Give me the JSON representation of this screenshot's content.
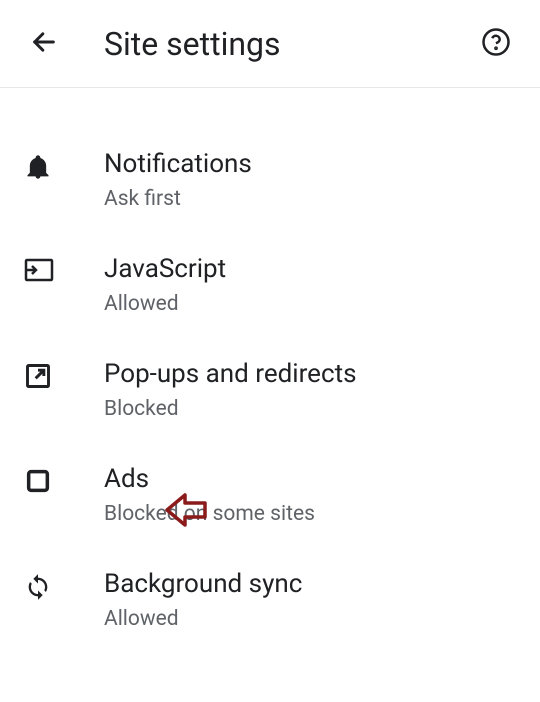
{
  "header": {
    "title": "Site settings"
  },
  "settings": [
    {
      "icon": "bell-icon",
      "title": "Notifications",
      "subtitle": "Ask first"
    },
    {
      "icon": "javascript-icon",
      "title": "JavaScript",
      "subtitle": "Allowed"
    },
    {
      "icon": "popup-icon",
      "title": "Pop-ups and redirects",
      "subtitle": "Blocked"
    },
    {
      "icon": "ads-icon",
      "title": "Ads",
      "subtitle": "Blocked on some sites"
    },
    {
      "icon": "sync-icon",
      "title": "Background sync",
      "subtitle": "Allowed"
    }
  ]
}
